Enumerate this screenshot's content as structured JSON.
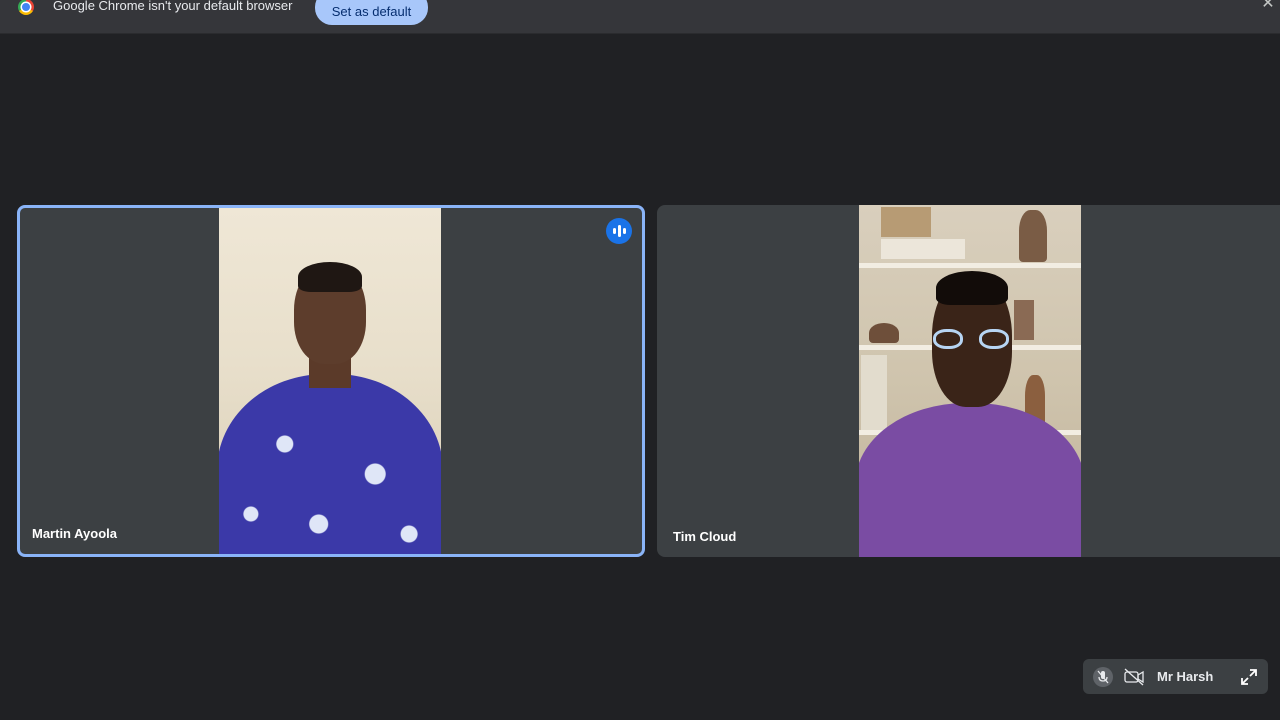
{
  "infobar": {
    "message": "Google Chrome isn't your default browser",
    "button_label": "Set as default",
    "close_glyph": "✕"
  },
  "participants": [
    {
      "name": "Martin Ayoola",
      "speaking": true,
      "active_border_color": "#8ab4f8"
    },
    {
      "name": "Tim Cloud",
      "speaking": false
    }
  ],
  "self_view": {
    "name": "Mr Harsh",
    "mic_icon": "mic-off-icon",
    "camera_icon": "camera-off-icon",
    "expand_icon": "expand-icon"
  },
  "colors": {
    "background": "#202124",
    "tile": "#3c4043",
    "accent": "#1a73e8",
    "button": "#a8c7fa"
  }
}
